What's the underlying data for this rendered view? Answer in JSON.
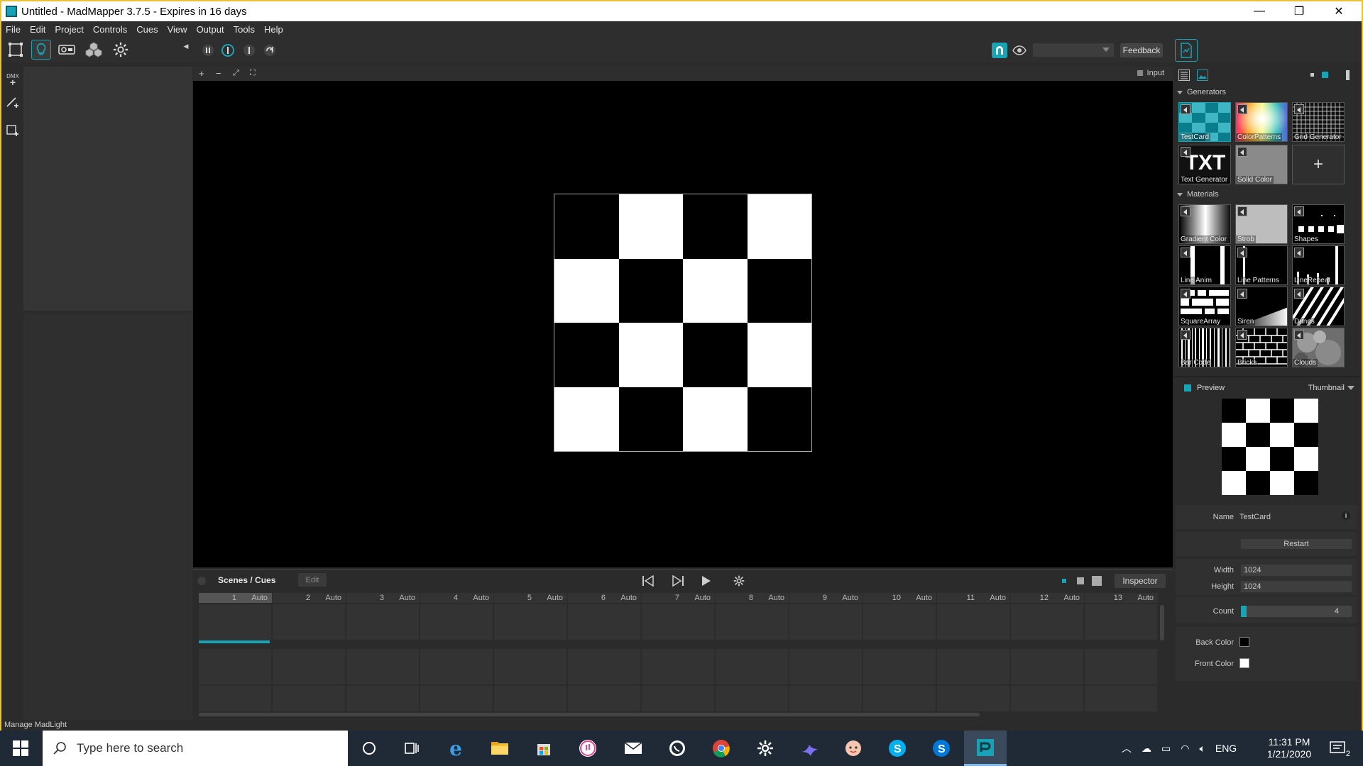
{
  "window": {
    "title": "Untitled - MadMapper 3.7.5 - Expires in 16 days",
    "minimize": "—",
    "restore": "❐",
    "close": "✕"
  },
  "menu": [
    "File",
    "Edit",
    "Project",
    "Controls",
    "Cues",
    "View",
    "Output",
    "Tools",
    "Help"
  ],
  "toolbar": {
    "feedback_label": "Feedback"
  },
  "left_tools": {
    "dmx_label": "DMX"
  },
  "viewport": {
    "zoom_in": "+",
    "zoom_out": "−",
    "fit": "⤢",
    "frame": "⛶",
    "input_label": "Input",
    "checker_cells": 4
  },
  "cues": {
    "section_label": "Scenes / Cues",
    "edit_label": "Edit",
    "inspector_label": "Inspector",
    "columns": [
      {
        "num": "1",
        "mode": "Auto"
      },
      {
        "num": "2",
        "mode": "Auto"
      },
      {
        "num": "3",
        "mode": "Auto"
      },
      {
        "num": "4",
        "mode": "Auto"
      },
      {
        "num": "5",
        "mode": "Auto"
      },
      {
        "num": "6",
        "mode": "Auto"
      },
      {
        "num": "7",
        "mode": "Auto"
      },
      {
        "num": "8",
        "mode": "Auto"
      },
      {
        "num": "9",
        "mode": "Auto"
      },
      {
        "num": "10",
        "mode": "Auto"
      },
      {
        "num": "11",
        "mode": "Auto"
      },
      {
        "num": "12",
        "mode": "Auto"
      },
      {
        "num": "13",
        "mode": "Auto"
      }
    ]
  },
  "library": {
    "generators_label": "Generators",
    "generators": [
      "TestCard",
      "ColorPatterns",
      "Grid Generator",
      "Text Generator",
      "Solid Color"
    ],
    "add_label": "+",
    "materials_label": "Materials",
    "materials": [
      "Gradient Color",
      "Strob",
      "Shapes",
      "Line Anim",
      "Line Patterns",
      "LineRepeat",
      "SquareArray",
      "Siren",
      "Dunes",
      "Bar Code",
      "Bricks",
      "Clouds"
    ],
    "txt_glyph": "TXT"
  },
  "preview": {
    "label": "Preview",
    "mode": "Thumbnail"
  },
  "properties": {
    "name_label": "Name",
    "name_value": "TestCard",
    "info": "i",
    "restart_label": "Restart",
    "width_label": "Width",
    "width_value": "1024",
    "height_label": "Height",
    "height_value": "1024",
    "count_label": "Count",
    "count_value": "4",
    "back_color_label": "Back Color",
    "back_color": "#000000",
    "front_color_label": "Front Color",
    "front_color": "#ffffff"
  },
  "status": {
    "text": "Manage MadLight"
  },
  "taskbar": {
    "search_placeholder": "Type here to search",
    "language": "ENG",
    "time": "11:31 PM",
    "date": "1/21/2020",
    "notifications": "2"
  },
  "colors": {
    "accent": "#1aa3b5",
    "title_border": "#e7c23a"
  }
}
